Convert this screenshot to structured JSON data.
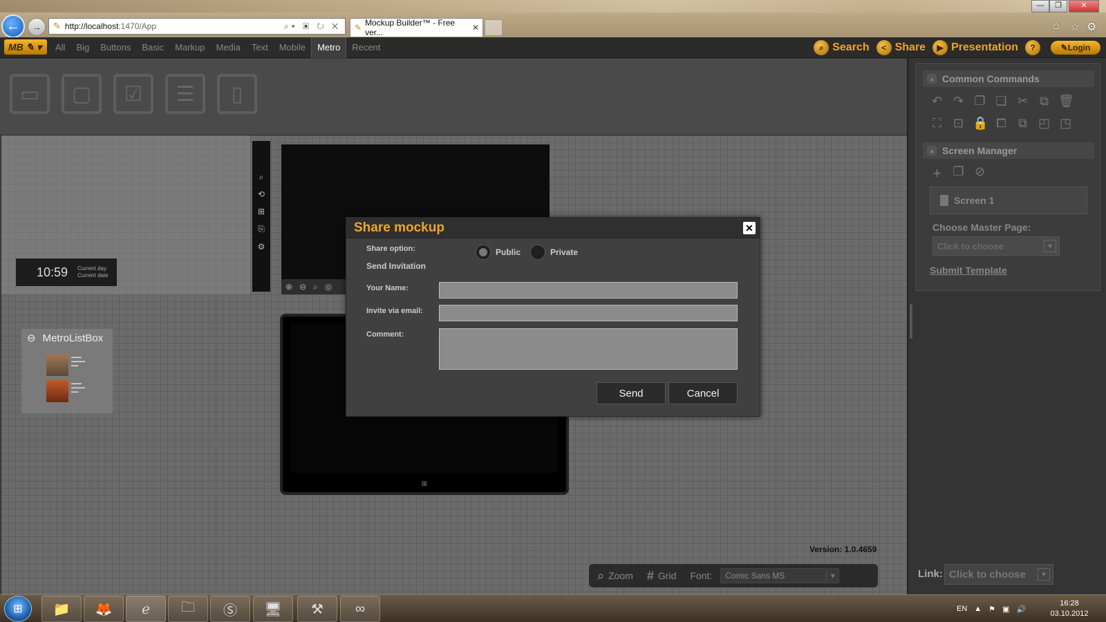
{
  "browser": {
    "url_host": "http://localhost",
    "url_rest": ":1470/App",
    "tab_title": "Mockup Builder™ - Free ver...",
    "back_icon": "back-arrow-icon",
    "forward_icon": "forward-arrow-icon"
  },
  "app": {
    "logo": "MB",
    "categories": [
      "All",
      "Big",
      "Buttons",
      "Basic",
      "Markup",
      "Media",
      "Text",
      "Mobile",
      "Metro",
      "Recent"
    ],
    "active_category": "Metro",
    "menu": {
      "search": "Search",
      "share": "Share",
      "presentation": "Presentation",
      "help": "?",
      "login": "Login"
    }
  },
  "canvas": {
    "clock_time": "10:59",
    "clock_day": "Current day",
    "clock_date": "Current date",
    "listbox_title": "MetroListBox",
    "version": "Version: 1.0.4659"
  },
  "bottombar": {
    "zoom": "Zoom",
    "grid": "Grid",
    "font_label": "Font:",
    "font_value": "Comic Sans MS"
  },
  "rightpanel": {
    "common_commands": "Common Commands",
    "screen_manager": "Screen Manager",
    "screen_item": "Screen 1",
    "master_label": "Choose Master Page:",
    "master_placeholder": "Click to choose",
    "submit_template": "Submit Template",
    "link_label": "Link:",
    "link_placeholder": "Click to choose"
  },
  "dialog": {
    "title": "Share mockup",
    "share_option_label": "Share option:",
    "public_label": "Public",
    "private_label": "Private",
    "selected_option": "Public",
    "send_invitation": "Send Invitation",
    "your_name_label": "Your Name:",
    "invite_label": "Invite via email:",
    "comment_label": "Comment:",
    "your_name_value": "",
    "invite_value": "",
    "comment_value": "",
    "send_button": "Send",
    "cancel_button": "Cancel"
  },
  "taskbar": {
    "language": "EN",
    "time": "16:28",
    "date": "03.10.2012"
  },
  "colors": {
    "accent": "#f0a623",
    "dialog_bg": "#404040",
    "canvas_bg": "#6b6b6b"
  }
}
